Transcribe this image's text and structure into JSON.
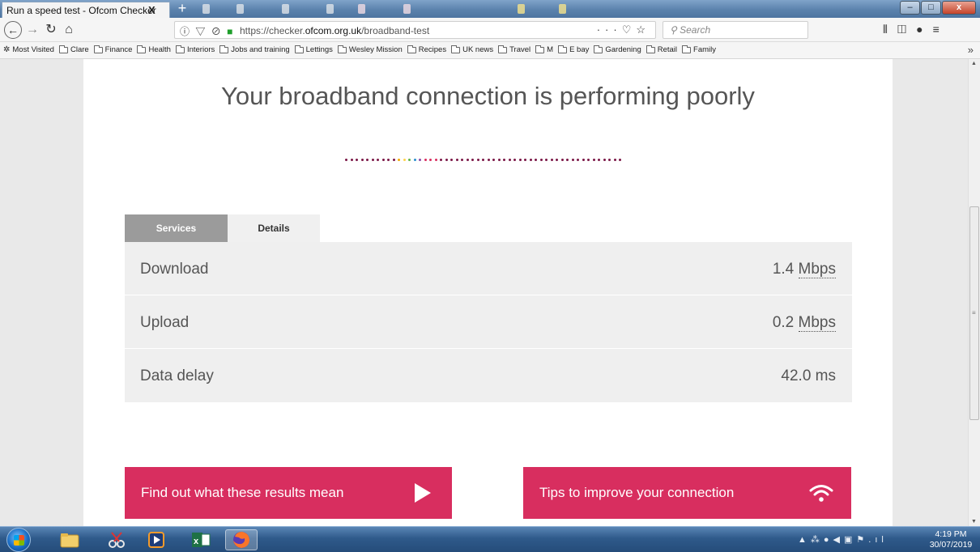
{
  "browser": {
    "tab_title": "Run a speed test - Ofcom Checker",
    "tab_close": "X",
    "new_tab": "+",
    "url_prefix": "https://checker.",
    "url_domain": "ofcom.org.uk",
    "url_path": "/broadband-test",
    "search_placeholder": "Search",
    "bookmarks": [
      "Clare",
      "Finance",
      "Health",
      "Interiors",
      "Jobs and training",
      "Lettings",
      "Wesley Mission",
      "Recipes",
      "UK news",
      "Travel",
      "M",
      "E bay",
      "Gardening",
      "Retail",
      "Family"
    ],
    "most_visited": "Most Visited",
    "bookmarks_more": "»"
  },
  "page": {
    "headline": "Your broadband connection is performing poorly",
    "tabs": {
      "services": "Services",
      "details": "Details"
    },
    "results": [
      {
        "label": "Download",
        "value": "1.4",
        "unit": "Mbps"
      },
      {
        "label": "Upload",
        "value": "0.2",
        "unit": "Mbps"
      },
      {
        "label": "Data delay",
        "value": "42.0 ms",
        "unit": ""
      }
    ],
    "cta_results": "Find out what these results mean",
    "cta_tips": "Tips to improve your connection",
    "dot_colors": [
      "#7a1746",
      "#7a1746",
      "#7a1746",
      "#7a1746",
      "#7a1746",
      "#7a1746",
      "#7a1746",
      "#7a1746",
      "#7a1746",
      "#7a1746",
      "#f2a900",
      "#ffd24a",
      "#5fb34a",
      "#2a8fcf",
      "#8b4aa8",
      "#d82e5f",
      "#d82e5f",
      "#d82e5f",
      "#7a1746",
      "#7a1746",
      "#7a1746",
      "#7a1746",
      "#7a1746",
      "#7a1746",
      "#7a1746",
      "#7a1746",
      "#7a1746",
      "#7a1746",
      "#7a1746",
      "#7a1746",
      "#7a1746",
      "#7a1746",
      "#7a1746",
      "#7a1746",
      "#7a1746",
      "#7a1746",
      "#7a1746",
      "#7a1746",
      "#7a1746",
      "#7a1746",
      "#7a1746",
      "#7a1746",
      "#7a1746",
      "#7a1746",
      "#7a1746",
      "#7a1746",
      "#7a1746",
      "#7a1746",
      "#7a1746",
      "#7a1746",
      "#7a1746",
      "#7a1746",
      "#7a1746"
    ],
    "accent_color": "#d82e5f"
  },
  "taskbar": {
    "time": "4:19 PM",
    "date": "30/07/2019"
  }
}
